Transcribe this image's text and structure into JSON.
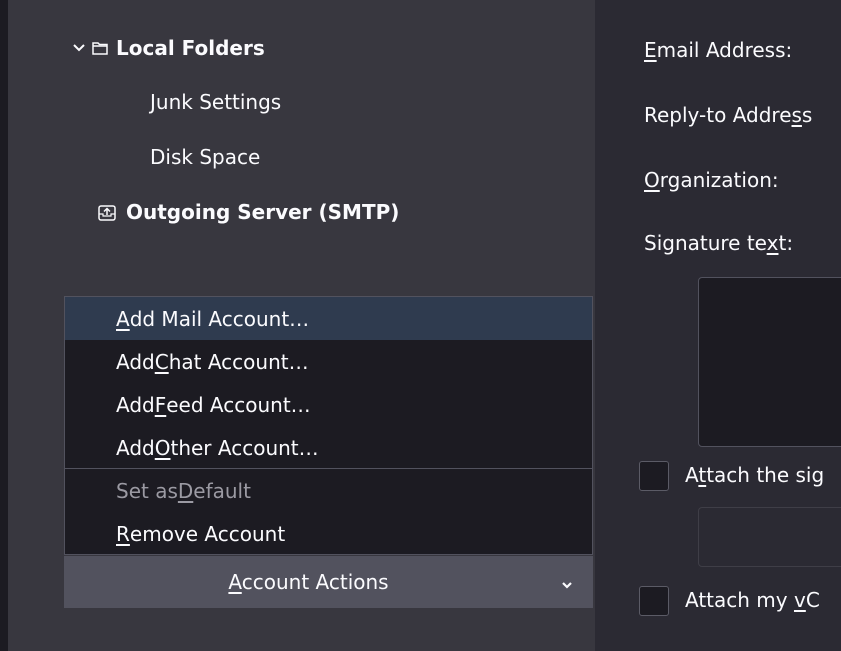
{
  "sidebar": {
    "local_folders": {
      "label": "Local Folders"
    },
    "items": [
      {
        "label": "Junk Settings"
      },
      {
        "label": "Disk Space"
      }
    ],
    "outgoing": {
      "label": "Outgoing Server (SMTP)"
    }
  },
  "menu": {
    "add_mail": {
      "prefix": "",
      "key": "A",
      "suffix": "dd Mail Account…"
    },
    "add_chat": {
      "prefix": "Add ",
      "key": "C",
      "suffix": "hat Account…"
    },
    "add_feed": {
      "prefix": "Add ",
      "key": "F",
      "suffix": "eed Account…"
    },
    "add_other": {
      "prefix": "Add ",
      "key": "O",
      "suffix": "ther Account…"
    },
    "set_default": {
      "prefix": "Set as ",
      "key": "D",
      "suffix": "efault"
    },
    "remove": {
      "prefix": "",
      "key": "R",
      "suffix": "emove Account"
    }
  },
  "actions_button": {
    "prefix": "",
    "key": "A",
    "suffix": "ccount Actions"
  },
  "identity": {
    "email": {
      "prefix": "",
      "key": "E",
      "suffix": "mail Address:"
    },
    "reply_to": {
      "prefix": "Reply-to Addre",
      "key": "s",
      "suffix": "s"
    },
    "organization": {
      "prefix": "",
      "key": "O",
      "suffix": "rganization:"
    },
    "signature": {
      "prefix": "Signature te",
      "key": "x",
      "suffix": "t:"
    },
    "attach_sig": {
      "prefix": "A",
      "key": "t",
      "suffix": "tach the sig"
    },
    "attach_vcard": {
      "prefix": "Attach my ",
      "key": "v",
      "suffix": "C"
    }
  }
}
